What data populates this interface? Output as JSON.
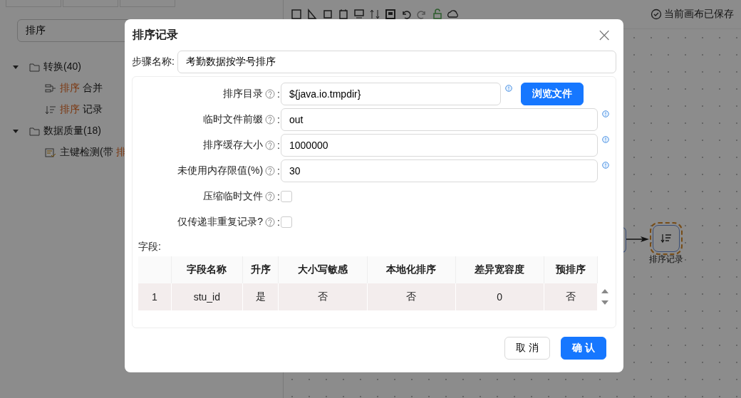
{
  "sidebar": {
    "search": {
      "value": "排序"
    },
    "tree": [
      {
        "label": "转换(40)",
        "expanded": true,
        "children": [
          {
            "parts": [
              {
                "text": "排序",
                "highlight": true
              },
              {
                "text": "合并",
                "highlight": false
              }
            ]
          },
          {
            "parts": [
              {
                "text": "排序",
                "highlight": true
              },
              {
                "text": "记录",
                "highlight": false
              }
            ]
          }
        ]
      },
      {
        "label": "数据质量(18)",
        "expanded": true,
        "children": [
          {
            "parts": [
              {
                "text": "主键检测(带",
                "highlight": false
              },
              {
                "text": "排",
                "highlight": true
              }
            ]
          }
        ]
      }
    ]
  },
  "canvas": {
    "save_status": "当前画布已保存",
    "node": {
      "label": "排序记录",
      "selected": true
    }
  },
  "dialog": {
    "title": "排序记录",
    "close": "×",
    "step_name": {
      "label": "步骤名称:",
      "value": "考勤数据按学号排序"
    },
    "fields": [
      {
        "kind": "text",
        "label": "排序目录",
        "colon": ":",
        "value": "${java.io.tmpdir}",
        "button": "浏览文件"
      },
      {
        "kind": "text",
        "label": "临时文件前缀",
        "colon": ":",
        "value": "out"
      },
      {
        "kind": "text",
        "label": "排序缓存大小",
        "colon": ":",
        "value": "1000000"
      },
      {
        "kind": "text",
        "label": "未使用内存限值(%)",
        "colon": ":",
        "value": "30"
      },
      {
        "kind": "checkbox",
        "label": "压缩临时文件",
        "colon": ":",
        "checked": false
      },
      {
        "kind": "checkbox",
        "label": "仅传递非重复记录?",
        "colon": ":",
        "checked": false
      }
    ],
    "table": {
      "label": "字段:",
      "columns": [
        "字段名称",
        "升序",
        "大小写敏感",
        "本地化排序",
        "差异宽容度",
        "预排序"
      ],
      "rows": [
        {
          "index": "1",
          "selected": true,
          "cells": [
            "stu_id",
            "是",
            "否",
            "否",
            "0",
            "否"
          ]
        }
      ]
    },
    "buttons": [
      {
        "label": "取 消",
        "primary": false
      },
      {
        "label": "确 认",
        "primary": true
      }
    ]
  }
}
